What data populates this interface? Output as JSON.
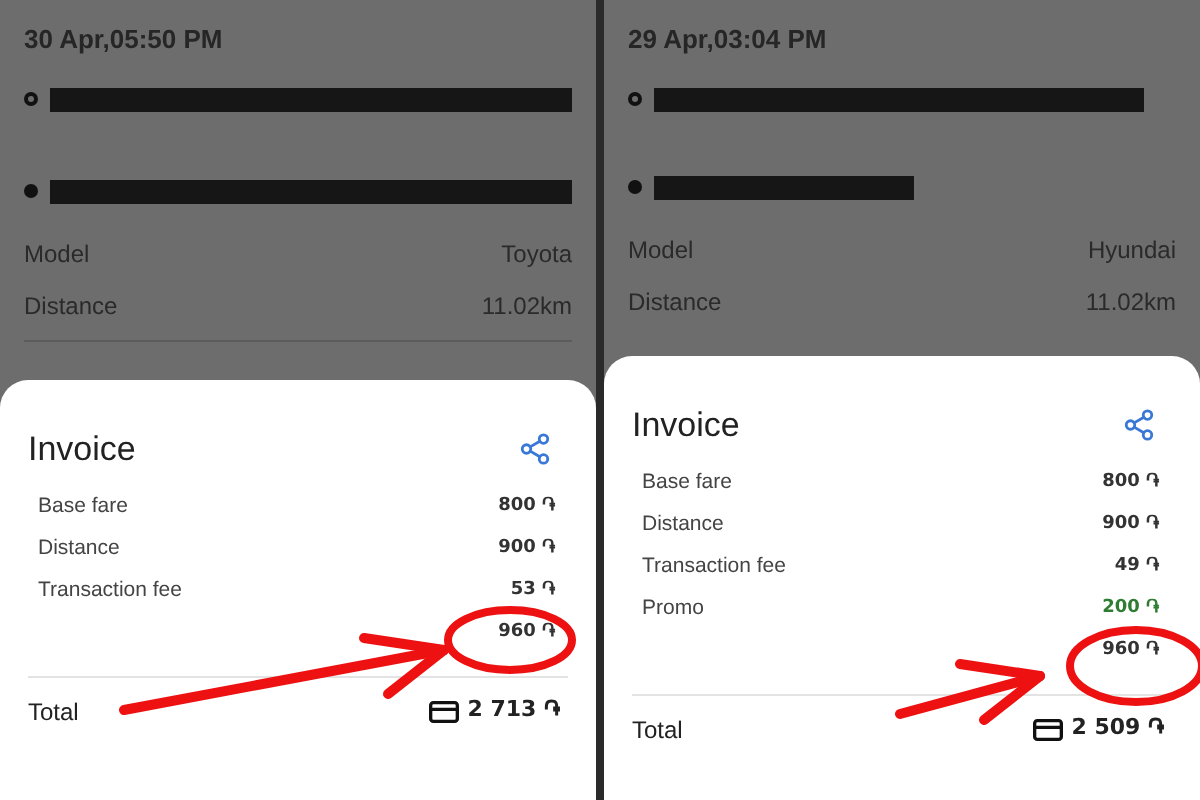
{
  "panels": [
    {
      "date": "30 Apr,05:50 PM",
      "stops": [
        {
          "kind": "start"
        },
        {
          "kind": "end"
        }
      ],
      "details": [
        {
          "label": "Model",
          "value": "Toyota"
        },
        {
          "label": "Distance",
          "value": "11.02km"
        }
      ],
      "invoice": {
        "title": "Invoice",
        "rows": [
          {
            "label": "Base fare",
            "amount": "800 ֏",
            "kind": "charge"
          },
          {
            "label": "Distance",
            "amount": "900 ֏",
            "kind": "charge"
          },
          {
            "label": "Transaction fee",
            "amount": "53 ֏",
            "kind": "charge"
          }
        ],
        "extra_amount": "960 ֏",
        "total_label": "Total",
        "total": "2 713 ֏"
      }
    },
    {
      "date": "29 Apr,03:04 PM",
      "stops": [
        {
          "kind": "start"
        },
        {
          "kind": "end"
        }
      ],
      "details": [
        {
          "label": "Model",
          "value": "Hyundai"
        },
        {
          "label": "Distance",
          "value": "11.02km"
        }
      ],
      "invoice": {
        "title": "Invoice",
        "rows": [
          {
            "label": "Base fare",
            "amount": "800 ֏",
            "kind": "charge"
          },
          {
            "label": "Distance",
            "amount": "900 ֏",
            "kind": "charge"
          },
          {
            "label": "Transaction fee",
            "amount": "49 ֏",
            "kind": "charge"
          },
          {
            "label": "Promo",
            "amount": "200 ֏",
            "kind": "discount"
          }
        ],
        "extra_amount": "960 ֏",
        "total_label": "Total",
        "total": "2 509 ֏"
      }
    }
  ]
}
